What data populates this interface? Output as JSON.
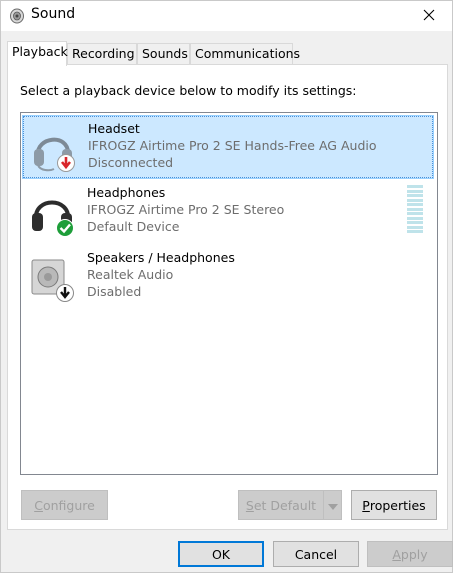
{
  "window": {
    "title": "Sound",
    "icon": "speaker-icon"
  },
  "tabs": [
    {
      "label": "Playback",
      "active": true
    },
    {
      "label": "Recording",
      "active": false
    },
    {
      "label": "Sounds",
      "active": false
    },
    {
      "label": "Communications",
      "active": false
    }
  ],
  "instruction": "Select a playback device below to modify its settings:",
  "devices": [
    {
      "name": "Headset",
      "description": "IFROGZ Airtime Pro 2 SE Hands-Free AG Audio",
      "status": "Disconnected",
      "icon": "headset-icon",
      "badge": "red-down-arrow-icon",
      "selected": true
    },
    {
      "name": "Headphones",
      "description": "IFROGZ Airtime Pro 2 SE Stereo",
      "status": "Default Device",
      "icon": "headphones-icon",
      "badge": "green-check-icon",
      "selected": false
    },
    {
      "name": "Speakers / Headphones",
      "description": "Realtek Audio",
      "status": "Disabled",
      "icon": "speaker-box-icon",
      "badge": "black-down-arrow-icon",
      "selected": false
    }
  ],
  "buttons": {
    "configure": {
      "label": "Configure",
      "mnemonic": "C",
      "rest": "onfigure"
    },
    "set_default": {
      "label": "Set Default",
      "mnemonic": "S",
      "rest": "et Default"
    },
    "properties": {
      "label": "Properties",
      "mnemonic": "P",
      "rest": "roperties"
    },
    "ok": {
      "label": "OK"
    },
    "cancel": {
      "label": "Cancel"
    },
    "apply": {
      "label": "Apply",
      "mnemonic": "A",
      "rest": "pply"
    }
  },
  "colors": {
    "selection": "#cce8ff",
    "accent": "#0078d7",
    "disabled_text": "#a0a0a0"
  }
}
